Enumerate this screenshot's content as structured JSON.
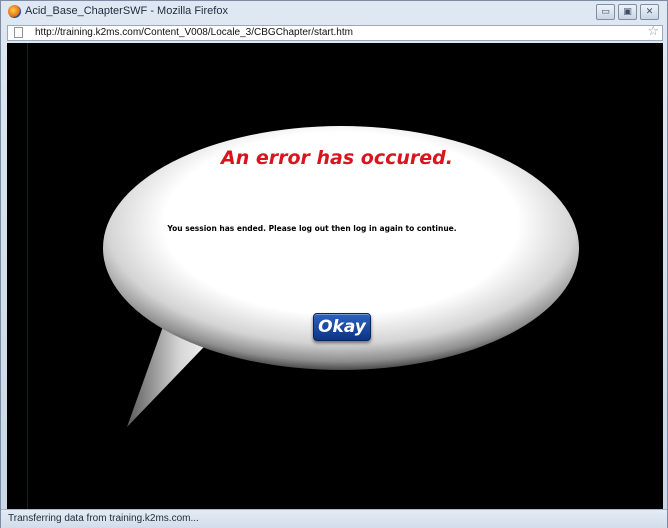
{
  "window": {
    "title": "Acid_Base_ChapterSWF - Mozilla Firefox",
    "controls": {
      "minimize": "▭",
      "maximize": "▣",
      "close": "✕"
    }
  },
  "address_bar": {
    "url": "http://training.k2ms.com/Content_V008/Locale_3/CBGChapter/start.htm"
  },
  "dialog": {
    "title": "An error has occured.",
    "message": "You session has ended. Please log out then log in again to continue.",
    "button_label": "Okay",
    "colors": {
      "title": "#d6151d",
      "button": "#1a4aa8"
    }
  },
  "status_bar": {
    "text": "Transferring data from training.k2ms.com..."
  }
}
